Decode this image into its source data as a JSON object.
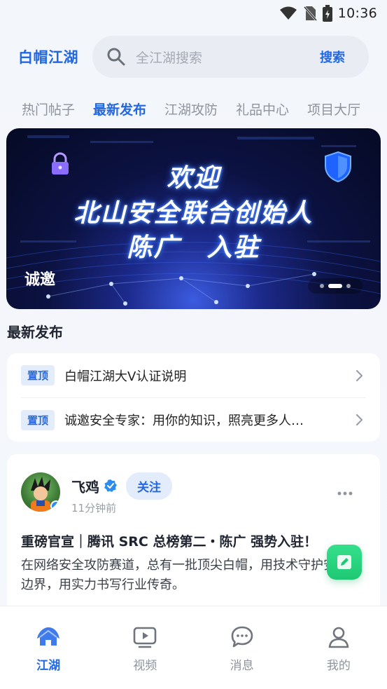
{
  "status_bar": {
    "time": "10:36"
  },
  "header": {
    "brand": "白帽江湖",
    "search_placeholder": "全江湖搜索",
    "search_button": "搜索"
  },
  "tabs": [
    {
      "label": "热门帖子",
      "active": false
    },
    {
      "label": "最新发布",
      "active": true
    },
    {
      "label": "江湖攻防",
      "active": false
    },
    {
      "label": "礼品中心",
      "active": false
    },
    {
      "label": "项目大厅",
      "active": false
    }
  ],
  "banner": {
    "line1": "欢迎",
    "line2": "北山安全联合创始人",
    "line3": "陈广　入驻",
    "caption": "诚邀",
    "slide_count": 3,
    "active_slide": 2
  },
  "section_title": "最新发布",
  "pinned": [
    {
      "tag": "置顶",
      "text": "白帽江湖大V认证说明"
    },
    {
      "tag": "置顶",
      "text": "诚邀安全专家：用你的知识，照亮更多人…"
    }
  ],
  "post": {
    "author": "飞鸡",
    "follow_label": "关注",
    "time_ago": "11分钟前",
    "title": "重磅官宣｜腾讯 SRC 总榜第二・陈广 强势入驻！",
    "body": "在网络安全攻防赛道，总有一批顶尖白帽，用技术守护安全边界，用实力书写行业传奇。"
  },
  "bottom_nav": [
    {
      "label": "江湖",
      "icon": "home-icon",
      "active": true
    },
    {
      "label": "视频",
      "icon": "video-icon",
      "active": false
    },
    {
      "label": "消息",
      "icon": "message-icon",
      "active": false
    },
    {
      "label": "我的",
      "icon": "profile-icon",
      "active": false
    }
  ],
  "colors": {
    "accent": "#2368e0",
    "tag_bg": "#e3ecfb",
    "fab": "#1fc873"
  }
}
